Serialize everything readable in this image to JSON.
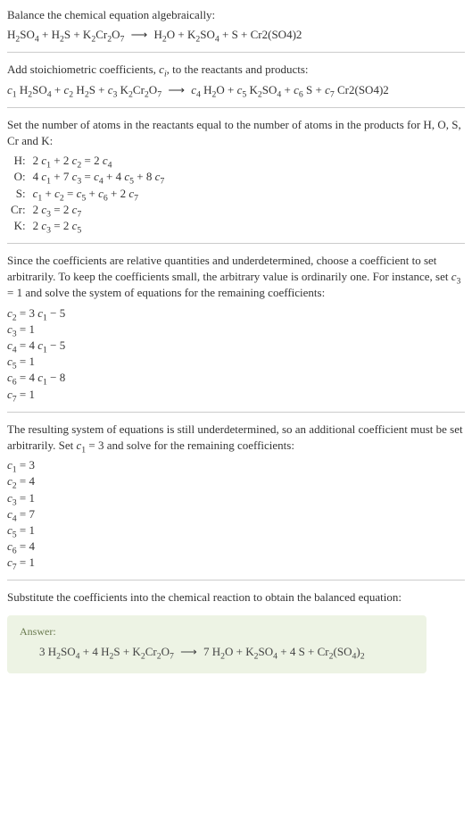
{
  "title": "Balance the chemical equation algebraically:",
  "eqn_unbalanced_html": "H<sub>2</sub>SO<sub>4</sub> + H<sub>2</sub>S + K<sub>2</sub>Cr<sub>2</sub>O<sub>7</sub> <span class='arrow'>⟶</span> H<sub>2</sub>O + K<sub>2</sub>SO<sub>4</sub> + S + Cr2(SO4)2",
  "stoich_text_html": "Add stoichiometric coefficients, <span class='ital'>c<sub>i</sub></span>, to the reactants and products:",
  "eqn_coeffs_html": "<span class='ital'>c</span><sub>1</sub> H<sub>2</sub>SO<sub>4</sub> + <span class='ital'>c</span><sub>2</sub> H<sub>2</sub>S + <span class='ital'>c</span><sub>3</sub> K<sub>2</sub>Cr<sub>2</sub>O<sub>7</sub> <span class='arrow'>⟶</span> <span class='ital'>c</span><sub>4</sub> H<sub>2</sub>O + <span class='ital'>c</span><sub>5</sub> K<sub>2</sub>SO<sub>4</sub> + <span class='ital'>c</span><sub>6</sub> S + <span class='ital'>c</span><sub>7</sub> Cr2(SO4)2",
  "atoms_text": "Set the number of atoms in the reactants equal to the number of atoms in the products for H, O, S, Cr and K:",
  "atom_eqs": [
    {
      "el": "H:",
      "eq_html": "2 <span class='ital'>c</span><sub>1</sub> + 2 <span class='ital'>c</span><sub>2</sub> = 2 <span class='ital'>c</span><sub>4</sub>"
    },
    {
      "el": "O:",
      "eq_html": "4 <span class='ital'>c</span><sub>1</sub> + 7 <span class='ital'>c</span><sub>3</sub> = <span class='ital'>c</span><sub>4</sub> + 4 <span class='ital'>c</span><sub>5</sub> + 8 <span class='ital'>c</span><sub>7</sub>"
    },
    {
      "el": "S:",
      "eq_html": "<span class='ital'>c</span><sub>1</sub> + <span class='ital'>c</span><sub>2</sub> = <span class='ital'>c</span><sub>5</sub> + <span class='ital'>c</span><sub>6</sub> + 2 <span class='ital'>c</span><sub>7</sub>"
    },
    {
      "el": "Cr:",
      "eq_html": "2 <span class='ital'>c</span><sub>3</sub> = 2 <span class='ital'>c</span><sub>7</sub>"
    },
    {
      "el": "K:",
      "eq_html": "2 <span class='ital'>c</span><sub>3</sub> = 2 <span class='ital'>c</span><sub>5</sub>"
    }
  ],
  "underdet_text_html": "Since the coefficients are relative quantities and underdetermined, choose a coefficient to set arbitrarily. To keep the coefficients small, the arbitrary value is ordinarily one. For instance, set <span class='ital'>c</span><sub>3</sub> = 1 and solve the system of equations for the remaining coefficients:",
  "param_eqs": [
    "<span class='ital'>c</span><sub>2</sub> = 3 <span class='ital'>c</span><sub>1</sub> − 5",
    "<span class='ital'>c</span><sub>3</sub> = 1",
    "<span class='ital'>c</span><sub>4</sub> = 4 <span class='ital'>c</span><sub>1</sub> − 5",
    "<span class='ital'>c</span><sub>5</sub> = 1",
    "<span class='ital'>c</span><sub>6</sub> = 4 <span class='ital'>c</span><sub>1</sub> − 8",
    "<span class='ital'>c</span><sub>7</sub> = 1"
  ],
  "second_text_html": "The resulting system of equations is still underdetermined, so an additional coefficient must be set arbitrarily. Set <span class='ital'>c</span><sub>1</sub> = 3 and solve for the remaining coefficients:",
  "final_coeffs": [
    "<span class='ital'>c</span><sub>1</sub> = 3",
    "<span class='ital'>c</span><sub>2</sub> = 4",
    "<span class='ital'>c</span><sub>3</sub> = 1",
    "<span class='ital'>c</span><sub>4</sub> = 7",
    "<span class='ital'>c</span><sub>5</sub> = 1",
    "<span class='ital'>c</span><sub>6</sub> = 4",
    "<span class='ital'>c</span><sub>7</sub> = 1"
  ],
  "subst_text": "Substitute the coefficients into the chemical reaction to obtain the balanced equation:",
  "answer_label": "Answer:",
  "answer_eqn_html": "3 H<sub>2</sub>SO<sub>4</sub> + 4 H<sub>2</sub>S + K<sub>2</sub>Cr<sub>2</sub>O<sub>7</sub> <span class='arrow'>⟶</span> 7 H<sub>2</sub>O + K<sub>2</sub>SO<sub>4</sub> + 4 S + Cr<sub>2</sub>(SO<sub>4</sub>)<sub>2</sub>"
}
